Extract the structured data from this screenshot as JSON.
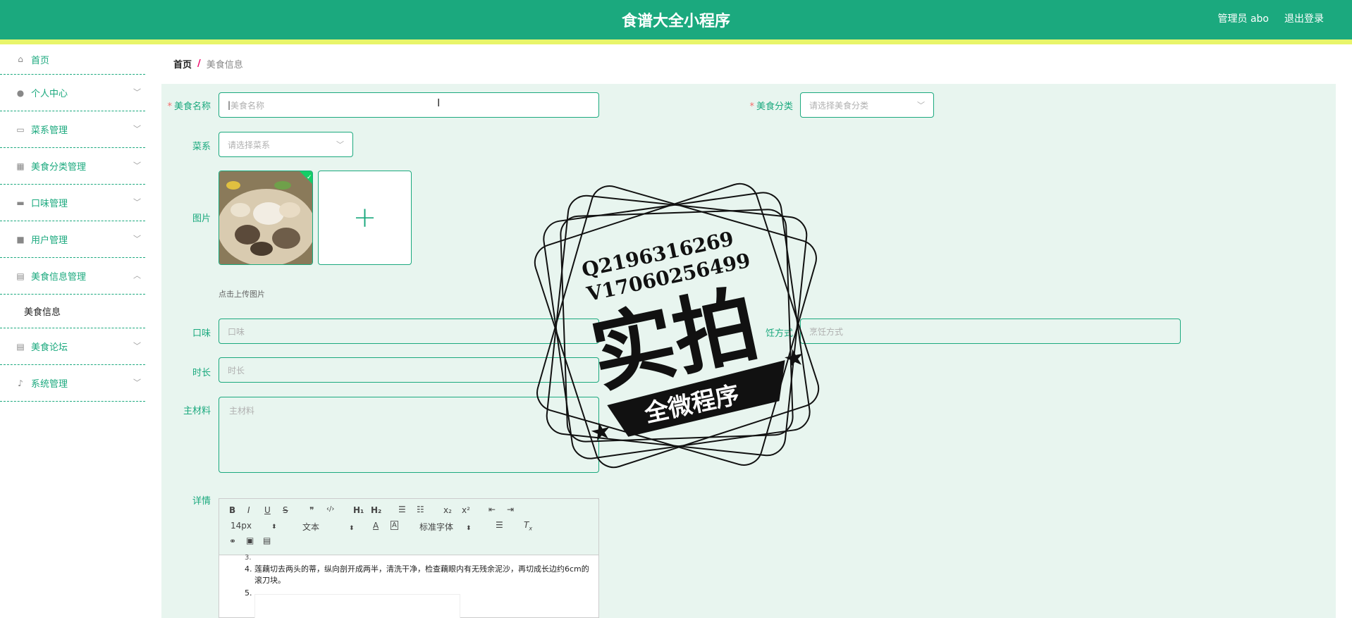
{
  "header": {
    "title": "食谱大全小程序",
    "admin_label": "管理员 abo",
    "logout_label": "退出登录",
    "bg_color": "#1ba97e",
    "strip_color": "#e8f56a"
  },
  "sidebar": {
    "items": [
      {
        "label": "首页",
        "icon": "home-icon"
      },
      {
        "label": "个人中心",
        "icon": "user-icon"
      },
      {
        "label": "菜系管理",
        "icon": "chat-icon"
      },
      {
        "label": "美食分类管理",
        "icon": "chart-icon"
      },
      {
        "label": "口味管理",
        "icon": "monitor-icon"
      },
      {
        "label": "用户管理",
        "icon": "briefcase-icon"
      },
      {
        "label": "美食信息管理",
        "icon": "clipboard-icon"
      },
      {
        "label": "美食论坛",
        "icon": "clipboard-check-icon"
      },
      {
        "label": "系统管理",
        "icon": "microphone-icon"
      }
    ],
    "submenu": {
      "label": "美食信息"
    }
  },
  "breadcrumb": {
    "home": "首页",
    "separator": "/",
    "current": "美食信息"
  },
  "form": {
    "name": {
      "label": "美食名称",
      "placeholder": "美食名称"
    },
    "category": {
      "label": "美食分类",
      "placeholder": "请选择美食分类"
    },
    "cuisine": {
      "label": "菜系",
      "placeholder": "请选择菜系"
    },
    "image": {
      "label": "图片",
      "hint": "点击上传图片",
      "add_symbol": "+"
    },
    "taste": {
      "label": "口味",
      "placeholder": "口味"
    },
    "cooking_method": {
      "label": "烹饪方式",
      "visible_label": "饪方式",
      "placeholder": "烹饪方式"
    },
    "duration": {
      "label": "时长",
      "placeholder": "时长"
    },
    "main_ingredients": {
      "label": "主材料",
      "placeholder": "主材料"
    },
    "details": {
      "label": "详情",
      "toolbar": {
        "bold": "B",
        "italic": "I",
        "underline": "U",
        "strike": "S",
        "quote": "❞",
        "code": "‹/›",
        "h1": "H₁",
        "h2": "H₂",
        "ordered_list": "☰",
        "bullet_list": "☷",
        "sub": "x₂",
        "sup": "x²",
        "outdent": "⇤",
        "indent": "⇥",
        "font_size": "14px",
        "text_style": "文本",
        "font_family": "标准字体",
        "link": "🔗",
        "image": "▣",
        "video": "▤"
      },
      "content": [
        "3.",
        "莲藕切去两头的蒂，纵向剖开成两半，清洗干净，检查藕眼内有无残余泥沙，再切成长边约6cm的滚刀块。",
        "5."
      ],
      "list_numbers": [
        "3.",
        "4.",
        "5."
      ]
    }
  },
  "watermark": {
    "line1": "Q2196316269",
    "line2": "V17060256499",
    "big_text": "实拍",
    "banner_text": "全微程序"
  },
  "colors": {
    "accent": "#1ba97e",
    "panel_bg": "#e8f5ef",
    "required": "#f56c6c"
  }
}
